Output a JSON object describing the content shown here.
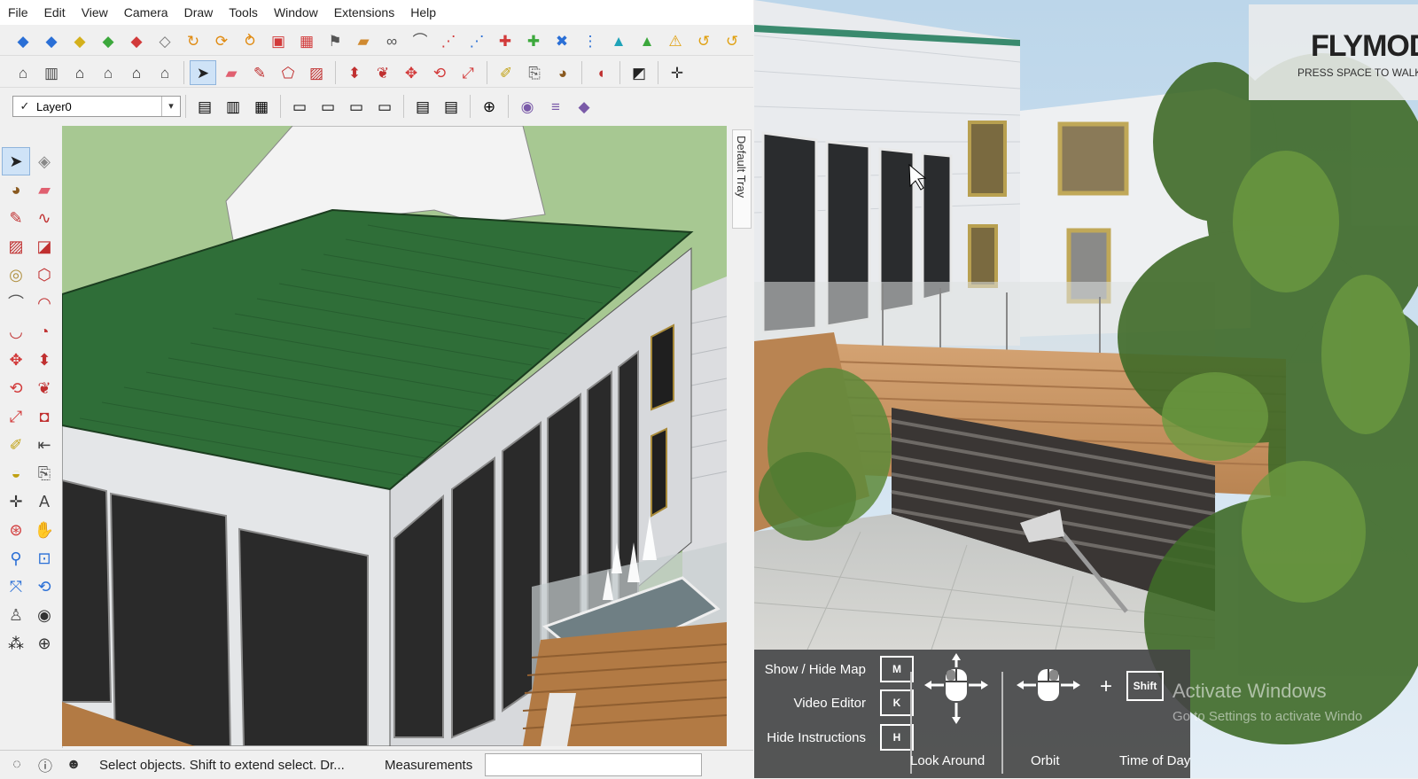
{
  "menu": [
    "File",
    "Edit",
    "View",
    "Camera",
    "Draw",
    "Tools",
    "Window",
    "Extensions",
    "Help"
  ],
  "toolbar_row1": [
    "cube-blue-icon",
    "cube-blue-icon",
    "cube-yellow-icon",
    "cube-green-icon",
    "cube-red-icon",
    "cube-outline-icon",
    "follow-me-icon",
    "rotate-arrow-icon",
    "twist-icon",
    "component-red-icon",
    "grid-icon",
    "flag-icon",
    "box-orange-icon",
    "link-icon",
    "arc-icon",
    "dots-icon",
    "dots-blue-icon",
    "cross-red-icon",
    "cross-green-icon",
    "cross-blue-icon",
    "grid-dots-icon",
    "cone-icon",
    "cone-green-icon",
    "warning-icon",
    "curl-icon",
    "curl-icon"
  ],
  "toolbar_row2": [
    "house-iso-icon",
    "house-side-icon",
    "house-front-icon",
    "house-right-icon",
    "house-back-icon",
    "house-left-icon",
    "|",
    "select-icon",
    "eraser-icon",
    "pencil-icon",
    "shape-icon",
    "rectangle-icon",
    "|",
    "pushpull-icon",
    "followme-icon",
    "move-icon",
    "rotate-icon",
    "scale-icon",
    "|",
    "tape-icon",
    "text-icon",
    "paint-icon",
    "|",
    "section-icon",
    "|",
    "erase-box-icon",
    "|",
    "axes-icon"
  ],
  "layer": {
    "check": "✓",
    "name": "Layer0",
    "dropdown": "▾"
  },
  "left_tools": [
    "select-icon",
    "component-icon",
    "paint-bucket-icon",
    "eraser-icon",
    "pencil-icon",
    "freehand-icon",
    "rectangle-icon",
    "rotated-rect-icon",
    "circle-icon",
    "polygon-icon",
    "arc-icon",
    "arc2-icon",
    "arc3-icon",
    "pie-icon",
    "move-icon",
    "pushpull-icon",
    "rotate-icon",
    "followme-icon",
    "scale-icon",
    "offset-icon",
    "tape-icon",
    "dimension-icon",
    "protractor-icon",
    "text-icon",
    "axes-icon",
    "3dtext-icon",
    "orbit-icon",
    "pan-icon",
    "zoom-icon",
    "zoom-window-icon",
    "zoom-extents-icon",
    "previous-icon",
    "position-camera-icon",
    "look-around-icon",
    "walk-icon",
    "section-plane-icon"
  ],
  "tray_label": "Default Tray",
  "status": {
    "text": "Select objects. Shift to extend select. Dr...",
    "measurements_label": "Measurements"
  },
  "lumion": {
    "mode_title": "FLYMOD",
    "mode_sub": "PRESS SPACE TO WALK ON TH",
    "instructions": [
      {
        "label": "Show / Hide Map",
        "key": "M"
      },
      {
        "label": "Video Editor",
        "key": "K"
      },
      {
        "label": "Hide Instructions",
        "key": "H"
      }
    ],
    "look_around": "Look Around",
    "orbit": "Orbit",
    "time_of_day": "Time of Day",
    "shift_key": "Shift",
    "plus": "+",
    "activate_line1": "Activate Windows",
    "activate_line2": "Go to Settings to activate Windo"
  },
  "colors": {
    "roof": "#2f6e38",
    "wall": "#e6e8ea",
    "glass": "#2b2b2b",
    "sky_ground": "#a7c892",
    "panel": "#444444"
  }
}
